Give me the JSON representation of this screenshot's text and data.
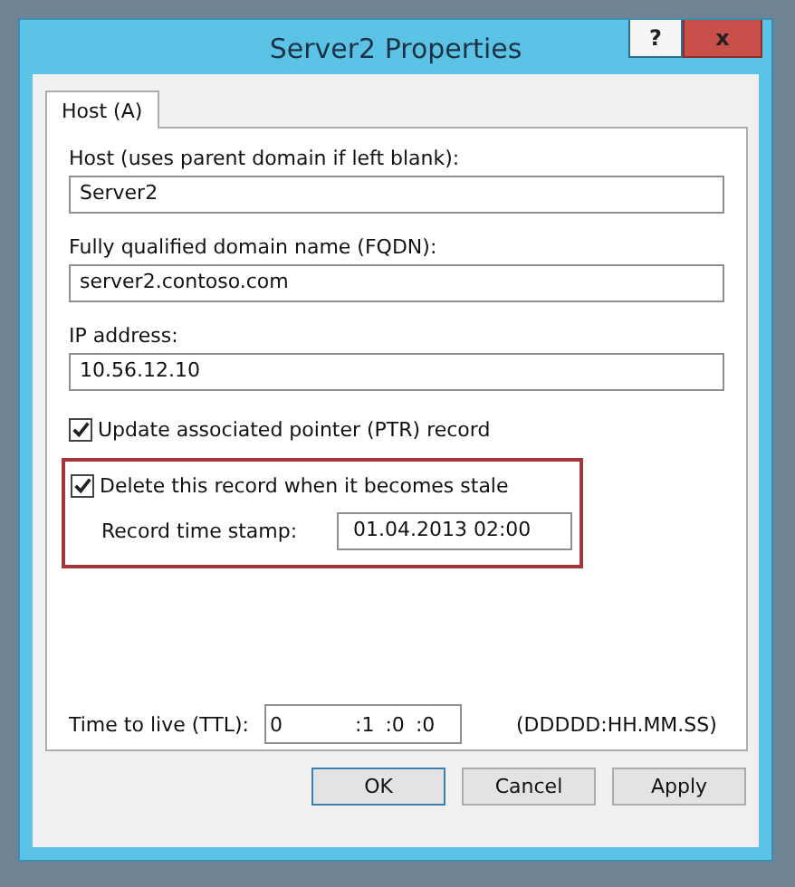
{
  "window": {
    "title": "Server2 Properties",
    "help_button": "?",
    "close_button": "x"
  },
  "tabs": [
    {
      "label": "Host (A)",
      "selected": true
    }
  ],
  "host": {
    "label": "Host (uses parent domain if left blank):",
    "value": "Server2"
  },
  "fqdn": {
    "label": "Fully qualified domain name (FQDN):",
    "value": "server2.contoso.com"
  },
  "ip": {
    "label": "IP address:",
    "value": "10.56.12.10"
  },
  "update_ptr": {
    "label": "Update associated pointer (PTR) record",
    "checked": true
  },
  "delete_stale": {
    "label": "Delete this record when it becomes stale",
    "checked": true
  },
  "timestamp": {
    "label": "Record time stamp:",
    "value": "01.04.2013 02:00"
  },
  "ttl": {
    "label": "Time to live (TTL):",
    "segments": [
      "0",
      ":1",
      ":0",
      ":0"
    ],
    "format": "(DDDDD:HH.MM.SS)"
  },
  "buttons": [
    "OK",
    "Cancel",
    "Apply"
  ]
}
